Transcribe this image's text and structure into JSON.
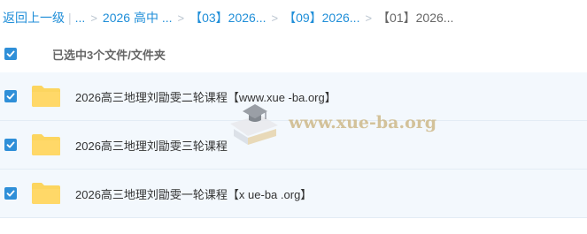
{
  "breadcrumb": {
    "back": "返回上一级",
    "pipe": "|",
    "ellipsis": "...",
    "sep": ">",
    "items": [
      "2026 高中 ...",
      "【03】2026...",
      "【09】2026...",
      "【01】2026..."
    ]
  },
  "selection": {
    "label": "已选中3个文件/文件夹",
    "checked": true
  },
  "files": [
    {
      "name": "2026高三地理刘勖雯二轮课程【www.xue -ba.org】",
      "type": "folder",
      "checked": true
    },
    {
      "name": "2026高三地理刘勖雯三轮课程",
      "type": "folder",
      "checked": true
    },
    {
      "name": "2026高三地理刘勖雯一轮课程【x ue-ba .org】",
      "type": "folder",
      "checked": true
    }
  ],
  "watermark": {
    "text": "www.xue-ba.org"
  },
  "colors": {
    "accent": "#2f8fd8",
    "link": "#1f8ed8",
    "folder": "#fcd55f",
    "row_bg": "#f3f8fd"
  },
  "icons": {
    "check": "check-icon",
    "folder": "folder-icon",
    "watermark": "graduation-cap-icon"
  }
}
